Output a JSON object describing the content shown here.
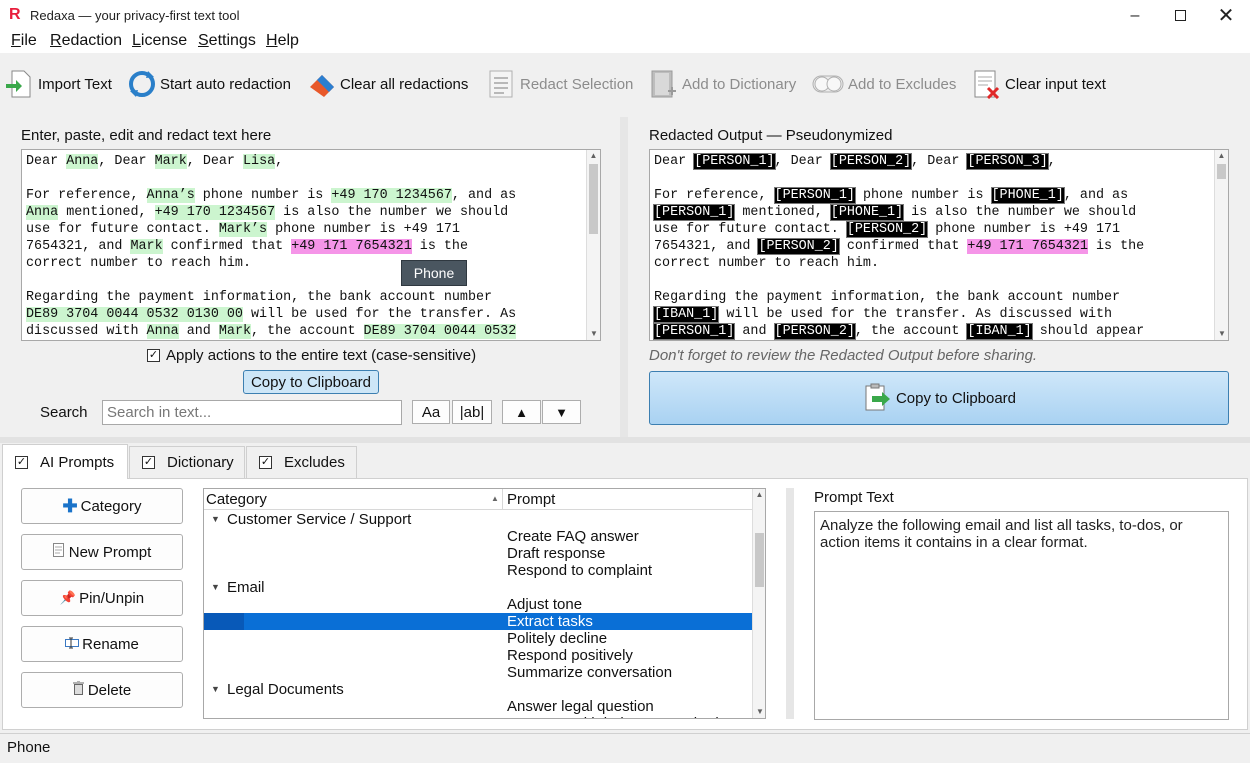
{
  "window": {
    "title": "Redaxa — your privacy-first text tool",
    "logo": "R"
  },
  "menu": [
    {
      "label": "File",
      "u": "F",
      "rest": "ile"
    },
    {
      "label": "Redaction",
      "u": "R",
      "rest": "edaction"
    },
    {
      "label": "License",
      "u": "L",
      "rest": "icense"
    },
    {
      "label": "Settings",
      "u": "S",
      "rest": "ettings"
    },
    {
      "label": "Help",
      "u": "H",
      "rest": "elp"
    }
  ],
  "toolbar": {
    "import": "Import Text",
    "auto": "Start auto redaction",
    "clear_redactions": "Clear all redactions",
    "redact_selection": "Redact Selection",
    "add_dictionary": "Add to Dictionary",
    "add_excludes": "Add to Excludes",
    "clear_input": "Clear input text"
  },
  "input_panel": {
    "label": "Enter, paste, edit and redact text here",
    "tooltip": "Phone",
    "apply_all": "Apply actions to the entire text (case-sensitive)",
    "copy": "Copy to Clipboard",
    "search_label": "Search",
    "search_placeholder": "Search in text...",
    "case_btn": "Aa",
    "word_btn": "|ab|",
    "up": "▲",
    "down": "▼"
  },
  "input_lines": [
    [
      [
        "Dear ",
        ""
      ],
      [
        "Anna",
        "g"
      ],
      [
        ", Dear ",
        ""
      ],
      [
        "Mark",
        "g"
      ],
      [
        ", Dear ",
        ""
      ],
      [
        "Lisa",
        "g"
      ],
      [
        ",",
        ""
      ]
    ],
    [],
    [
      [
        "For reference, ",
        ""
      ],
      [
        "Anna’s",
        "g"
      ],
      [
        " phone number is ",
        ""
      ],
      [
        "+49 170 1234567",
        "g"
      ],
      [
        ", and as",
        ""
      ]
    ],
    [
      [
        "Anna",
        "g"
      ],
      [
        " mentioned, ",
        ""
      ],
      [
        "+49 170 1234567",
        "g"
      ],
      [
        " is also the number we should",
        ""
      ]
    ],
    [
      [
        "use for future contact. ",
        ""
      ],
      [
        "Mark’s",
        "g"
      ],
      [
        " phone number is +49 171",
        ""
      ]
    ],
    [
      [
        "7654321, and ",
        ""
      ],
      [
        "Mark",
        "g"
      ],
      [
        " confirmed that ",
        ""
      ],
      [
        "+49 171 7654321",
        "p"
      ],
      [
        " is the",
        ""
      ]
    ],
    [
      [
        "correct number to reach him.",
        ""
      ]
    ],
    [],
    [
      [
        "Regarding the payment information, the bank account number",
        ""
      ]
    ],
    [
      [
        "DE89 3704 0044 0532 0130 00",
        "g"
      ],
      [
        " will be used for the transfer. As",
        ""
      ]
    ],
    [
      [
        "discussed with ",
        ""
      ],
      [
        "Anna",
        "g"
      ],
      [
        " and ",
        ""
      ],
      [
        "Mark",
        "g"
      ],
      [
        ", the account ",
        ""
      ],
      [
        "DE89 3704 0044 0532",
        "g"
      ]
    ]
  ],
  "output_panel": {
    "label": "Redacted Output — Pseudonymized",
    "hint": "Don't forget to review the Redacted Output before sharing.",
    "copy": "Copy to Clipboard"
  },
  "output_lines": [
    [
      [
        "Dear ",
        ""
      ],
      [
        "[PERSON_1]",
        "k"
      ],
      [
        ", Dear ",
        ""
      ],
      [
        "[PERSON_2]",
        "k"
      ],
      [
        ", Dear ",
        ""
      ],
      [
        "[PERSON_3]",
        "k"
      ],
      [
        ",",
        ""
      ]
    ],
    [],
    [
      [
        "For reference, ",
        ""
      ],
      [
        "[PERSON_1]",
        "k"
      ],
      [
        " phone number is ",
        ""
      ],
      [
        "[PHONE_1]",
        "k"
      ],
      [
        ", and as",
        ""
      ]
    ],
    [
      [
        "[PERSON_1]",
        "k"
      ],
      [
        " mentioned, ",
        ""
      ],
      [
        "[PHONE_1]",
        "k"
      ],
      [
        " is also the number we should",
        ""
      ]
    ],
    [
      [
        "use for future contact. ",
        ""
      ],
      [
        "[PERSON_2]",
        "k"
      ],
      [
        " phone number is +49 171",
        ""
      ]
    ],
    [
      [
        "7654321, and ",
        ""
      ],
      [
        "[PERSON_2]",
        "k"
      ],
      [
        " confirmed that ",
        ""
      ],
      [
        "+49 171 7654321",
        "p"
      ],
      [
        " is the",
        ""
      ]
    ],
    [
      [
        "correct number to reach him.",
        ""
      ]
    ],
    [],
    [
      [
        "Regarding the payment information, the bank account number",
        ""
      ]
    ],
    [
      [
        "[IBAN_1]",
        "k"
      ],
      [
        " will be used for the transfer. As discussed with",
        ""
      ]
    ],
    [
      [
        "[PERSON_1]",
        "k"
      ],
      [
        " and ",
        ""
      ],
      [
        "[PERSON_2]",
        "k"
      ],
      [
        ", the account ",
        ""
      ],
      [
        "[IBAN_1]",
        "k"
      ],
      [
        " should appear",
        ""
      ]
    ]
  ],
  "tabs": [
    {
      "label": "AI Prompts",
      "checked": true
    },
    {
      "label": "Dictionary",
      "checked": true
    },
    {
      "label": "Excludes",
      "checked": true
    }
  ],
  "side_buttons": {
    "category": "Category",
    "new_prompt": "New Prompt",
    "pin": "Pin/Unpin",
    "rename": "Rename",
    "delete": "Delete"
  },
  "tree": {
    "col_category": "Category",
    "col_prompt": "Prompt",
    "rows": [
      {
        "type": "cat",
        "text": "Customer Service / Support"
      },
      {
        "type": "item",
        "text": "Create FAQ answer"
      },
      {
        "type": "item",
        "text": "Draft response"
      },
      {
        "type": "item",
        "text": "Respond to complaint"
      },
      {
        "type": "cat",
        "text": "Email"
      },
      {
        "type": "item",
        "text": "Adjust tone"
      },
      {
        "type": "item",
        "text": "Extract tasks",
        "selected": true
      },
      {
        "type": "item",
        "text": "Politely decline"
      },
      {
        "type": "item",
        "text": "Respond positively"
      },
      {
        "type": "item",
        "text": "Summarize conversation"
      },
      {
        "type": "cat",
        "text": "Legal Documents"
      },
      {
        "type": "item",
        "text": "Answer legal question"
      },
      {
        "type": "item",
        "text": "Compare with industry standard"
      }
    ]
  },
  "prompt_text": {
    "label": "Prompt Text",
    "value": "Analyze the following email and list all tasks, to-dos, or action items it contains in a clear format."
  },
  "status": {
    "text": "Phone"
  },
  "colors": {
    "green_highlight": "#ccf5cf",
    "pink_highlight": "#f595e8",
    "selection": "#0a6fd6",
    "blue_button": "#cde6f7"
  }
}
